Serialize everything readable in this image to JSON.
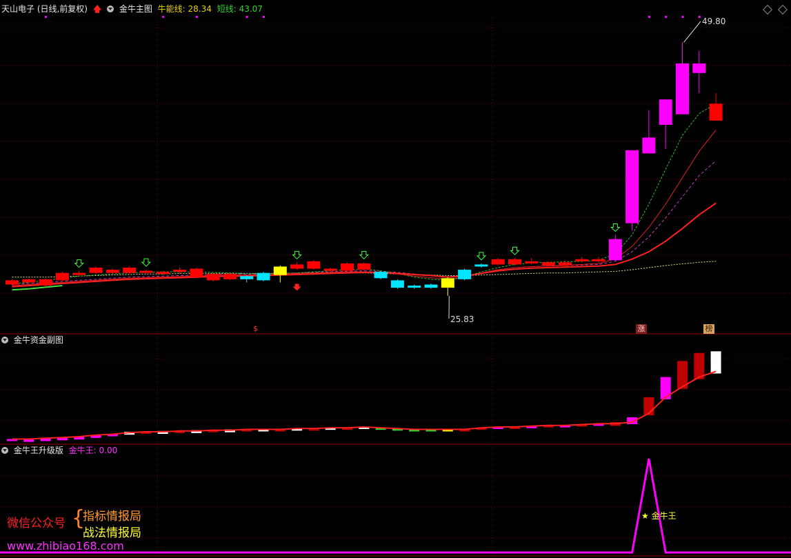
{
  "header_main": {
    "stock": "天山电子 (日线,前复权)",
    "indicator": "金牛主图",
    "bull_label": "牛能线: 28.34",
    "short_label": "短线: 43.07"
  },
  "header_sub1": {
    "indicator": "金牛资金副图"
  },
  "header_sub2": {
    "indicator": "金牛王升级版",
    "value_label": "金牛王: 0.00"
  },
  "annotations": {
    "high": "49.80",
    "low": "25.83",
    "zhang_badge": "涨",
    "bang_badge": "榜",
    "s_badge": "$",
    "king_label": "★ 金牛王"
  },
  "watermark": {
    "wechat": "微信公众号",
    "brace": "{",
    "line1": "指标情报局",
    "line2": "战法情报局",
    "url": "www.zhibiao168.com"
  },
  "colors": {
    "up": "#ff0000",
    "down": "#00e5ff",
    "magenta": "#ff00ff",
    "yellow": "#ffff00",
    "grid": "#7a0000",
    "green": "#35d235"
  },
  "chart_data": {
    "type": "candlestick",
    "price_range": [
      22.5,
      52.5
    ],
    "candles": [
      {
        "o": 26.9,
        "c": 27.3,
        "h": 27.4,
        "l": 26.8,
        "k": "r"
      },
      {
        "o": 27.1,
        "c": 27.4,
        "h": 27.5,
        "l": 27.0,
        "k": "r"
      },
      {
        "o": 26.8,
        "c": 27.4,
        "h": 27.5,
        "l": 26.7,
        "k": "r"
      },
      {
        "o": 27.3,
        "c": 28.0,
        "h": 28.1,
        "l": 27.2,
        "k": "r"
      },
      {
        "o": 27.8,
        "c": 28.0,
        "h": 28.2,
        "l": 27.7,
        "k": "r"
      },
      {
        "o": 28.0,
        "c": 28.5,
        "h": 28.6,
        "l": 27.9,
        "k": "r"
      },
      {
        "o": 28.0,
        "c": 28.3,
        "h": 28.4,
        "l": 27.9,
        "k": "r"
      },
      {
        "o": 28.0,
        "c": 28.5,
        "h": 28.6,
        "l": 27.9,
        "k": "r"
      },
      {
        "o": 28.0,
        "c": 28.2,
        "h": 28.3,
        "l": 27.9,
        "k": "r"
      },
      {
        "o": 27.9,
        "c": 28.1,
        "h": 28.2,
        "l": 27.8,
        "k": "r"
      },
      {
        "o": 28.1,
        "c": 28.3,
        "h": 28.5,
        "l": 27.9,
        "k": "r"
      },
      {
        "o": 27.6,
        "c": 28.4,
        "h": 28.5,
        "l": 27.5,
        "k": "r"
      },
      {
        "o": 27.3,
        "c": 27.9,
        "h": 28.0,
        "l": 27.2,
        "k": "r"
      },
      {
        "o": 27.4,
        "c": 27.9,
        "h": 28.0,
        "l": 27.3,
        "k": "r"
      },
      {
        "o": 27.7,
        "c": 27.4,
        "h": 27.8,
        "l": 27.1,
        "k": "c"
      },
      {
        "o": 28.0,
        "c": 27.3,
        "h": 28.1,
        "l": 27.2,
        "k": "c"
      },
      {
        "o": 27.8,
        "c": 28.6,
        "h": 28.7,
        "l": 27.1,
        "k": "y"
      },
      {
        "o": 28.4,
        "c": 28.8,
        "h": 29.0,
        "l": 28.3,
        "k": "r"
      },
      {
        "o": 28.4,
        "c": 29.1,
        "h": 29.2,
        "l": 28.3,
        "k": "r"
      },
      {
        "o": 28.2,
        "c": 28.4,
        "h": 28.5,
        "l": 28.1,
        "k": "r"
      },
      {
        "o": 28.2,
        "c": 28.9,
        "h": 29.0,
        "l": 28.1,
        "k": "r"
      },
      {
        "o": 28.3,
        "c": 28.9,
        "h": 29.0,
        "l": 28.2,
        "k": "r"
      },
      {
        "o": 28.1,
        "c": 27.5,
        "h": 28.2,
        "l": 27.4,
        "k": "c"
      },
      {
        "o": 27.3,
        "c": 26.6,
        "h": 27.4,
        "l": 26.5,
        "k": "c"
      },
      {
        "o": 26.8,
        "c": 26.6,
        "h": 26.9,
        "l": 26.5,
        "k": "c"
      },
      {
        "o": 26.9,
        "c": 26.6,
        "h": 27.0,
        "l": 26.5,
        "k": "c"
      },
      {
        "o": 26.6,
        "c": 27.5,
        "h": 27.6,
        "l": 25.83,
        "k": "y"
      },
      {
        "o": 27.4,
        "c": 28.3,
        "h": 28.4,
        "l": 27.3,
        "k": "c"
      },
      {
        "o": 28.6,
        "c": 28.8,
        "h": 28.9,
        "l": 28.5,
        "k": "c"
      },
      {
        "o": 28.8,
        "c": 29.3,
        "h": 29.4,
        "l": 28.7,
        "k": "r"
      },
      {
        "o": 28.8,
        "c": 29.3,
        "h": 29.4,
        "l": 28.7,
        "k": "r"
      },
      {
        "o": 28.9,
        "c": 29.1,
        "h": 29.4,
        "l": 28.8,
        "k": "r"
      },
      {
        "o": 28.7,
        "c": 29.0,
        "h": 29.1,
        "l": 28.6,
        "k": "r"
      },
      {
        "o": 28.7,
        "c": 29.0,
        "h": 29.2,
        "l": 28.6,
        "k": "r"
      },
      {
        "o": 29.1,
        "c": 29.3,
        "h": 29.5,
        "l": 29.0,
        "k": "r"
      },
      {
        "o": 29.1,
        "c": 29.3,
        "h": 29.5,
        "l": 29.0,
        "k": "r"
      },
      {
        "o": 29.2,
        "c": 31.2,
        "h": 31.6,
        "l": 29.1,
        "k": "m"
      },
      {
        "o": 32.7,
        "c": 39.6,
        "h": 39.6,
        "l": 32.0,
        "k": "m"
      },
      {
        "o": 39.3,
        "c": 40.8,
        "h": 43.4,
        "l": 39.3,
        "k": "m"
      },
      {
        "o": 42.0,
        "c": 44.4,
        "h": 44.4,
        "l": 39.7,
        "k": "m"
      },
      {
        "o": 43.0,
        "c": 47.8,
        "h": 49.8,
        "l": 43.0,
        "k": "m"
      },
      {
        "o": 46.9,
        "c": 47.8,
        "h": 49.0,
        "l": 45.0,
        "k": "m"
      },
      {
        "o": 44.0,
        "c": 42.4,
        "h": 45.0,
        "l": 42.4,
        "k": "r"
      }
    ],
    "ma_red": [
      26.7,
      26.8,
      26.9,
      27.0,
      27.1,
      27.2,
      27.3,
      27.4,
      27.45,
      27.5,
      27.55,
      27.6,
      27.65,
      27.7,
      27.7,
      27.75,
      27.8,
      27.85,
      27.9,
      27.95,
      28.0,
      28.05,
      28.05,
      27.95,
      27.85,
      27.75,
      27.6,
      27.7,
      27.95,
      28.2,
      28.35,
      28.45,
      28.5,
      28.55,
      28.6,
      28.65,
      28.8,
      29.3,
      30.0,
      31.0,
      32.2,
      33.5,
      34.6
    ],
    "ma_thin_red": [
      26.8,
      26.9,
      27.0,
      27.1,
      27.2,
      27.3,
      27.4,
      27.5,
      27.55,
      27.6,
      27.65,
      27.7,
      27.75,
      27.8,
      27.8,
      27.85,
      27.9,
      27.95,
      28.0,
      28.05,
      28.1,
      28.1,
      28.05,
      27.9,
      27.7,
      27.55,
      27.4,
      27.6,
      28.0,
      28.3,
      28.5,
      28.6,
      28.65,
      28.7,
      28.8,
      28.9,
      29.3,
      30.5,
      32.3,
      34.5,
      37.0,
      39.5,
      41.5
    ],
    "ma_green_dash": [
      27.0,
      27.1,
      27.3,
      27.5,
      27.7,
      27.8,
      27.9,
      28.0,
      28.05,
      28.1,
      28.1,
      28.1,
      28.05,
      28.0,
      27.95,
      27.9,
      27.95,
      28.0,
      28.1,
      28.2,
      28.3,
      28.35,
      28.2,
      27.95,
      27.6,
      27.4,
      27.3,
      27.6,
      28.1,
      28.5,
      28.8,
      28.95,
      29.0,
      29.05,
      29.1,
      29.2,
      29.8,
      31.6,
      34.5,
      37.8,
      41.0,
      43.07,
      44.0
    ],
    "ma_purple_dash": [
      26.9,
      27.0,
      27.1,
      27.2,
      27.3,
      27.4,
      27.5,
      27.6,
      27.65,
      27.7,
      27.75,
      27.8,
      27.85,
      27.9,
      27.9,
      27.9,
      27.95,
      28.0,
      28.05,
      28.1,
      28.15,
      28.2,
      28.15,
      28.05,
      27.9,
      27.75,
      27.65,
      27.75,
      28.0,
      28.3,
      28.5,
      28.6,
      28.65,
      28.7,
      28.75,
      28.8,
      29.1,
      30.0,
      31.4,
      33.2,
      35.2,
      37.2,
      38.6
    ],
    "ma_yellow_dash": [
      27.6,
      27.6,
      27.6,
      27.65,
      27.7,
      27.75,
      27.8,
      27.85,
      27.9,
      27.9,
      27.95,
      27.95,
      27.95,
      27.95,
      27.95,
      27.95,
      27.95,
      27.95,
      28.0,
      28.0,
      28.0,
      28.0,
      27.95,
      27.9,
      27.85,
      27.8,
      27.75,
      27.75,
      27.8,
      27.85,
      27.9,
      27.95,
      28.0,
      28.0,
      28.05,
      28.1,
      28.15,
      28.3,
      28.5,
      28.7,
      28.85,
      29.0,
      29.1
    ],
    "ma_green_early": [
      26.4,
      26.5,
      26.65,
      26.8,
      null
    ],
    "sub_candles": [
      3,
      2,
      3,
      4,
      5,
      7,
      9,
      12,
      12,
      13,
      13,
      14,
      14,
      15,
      15,
      15,
      15,
      16,
      16,
      17,
      17,
      18,
      17,
      16,
      15,
      15,
      15,
      16,
      17,
      18,
      18,
      19,
      20,
      20,
      21,
      22,
      24,
      30,
      55,
      80,
      100,
      110,
      112
    ],
    "sub_kinds": [
      "m",
      "m",
      "m",
      "m",
      "m",
      "m",
      "m",
      "w",
      "r",
      "w",
      "r",
      "w",
      "r",
      "w",
      "r",
      "w",
      "r",
      "w",
      "r",
      "w",
      "r",
      "w",
      "g",
      "g",
      "g",
      "g",
      "y",
      "r",
      "r",
      "m",
      "r",
      "m",
      "r",
      "m",
      "r",
      "m",
      "r",
      "m",
      "r",
      "m",
      "r",
      "r",
      "w"
    ],
    "sub_line": [
      3,
      3,
      4,
      5,
      6,
      8,
      9,
      11,
      12,
      12,
      13,
      13,
      14,
      14,
      15,
      15,
      15,
      16,
      16,
      17,
      17,
      18,
      17,
      16,
      15,
      15,
      15,
      15,
      17,
      18,
      18,
      19,
      20,
      20,
      21,
      22,
      22,
      24,
      35,
      55,
      68,
      80,
      87
    ],
    "king_values": [
      0,
      0,
      0,
      0,
      0,
      0,
      0,
      0,
      0,
      0,
      0,
      0,
      0,
      0,
      0,
      0,
      0,
      0,
      0,
      0,
      0,
      0,
      0,
      0,
      0,
      0,
      0,
      0,
      0,
      0,
      0,
      0,
      0,
      0,
      0,
      0,
      0,
      0,
      1,
      0,
      0,
      0,
      0
    ]
  }
}
